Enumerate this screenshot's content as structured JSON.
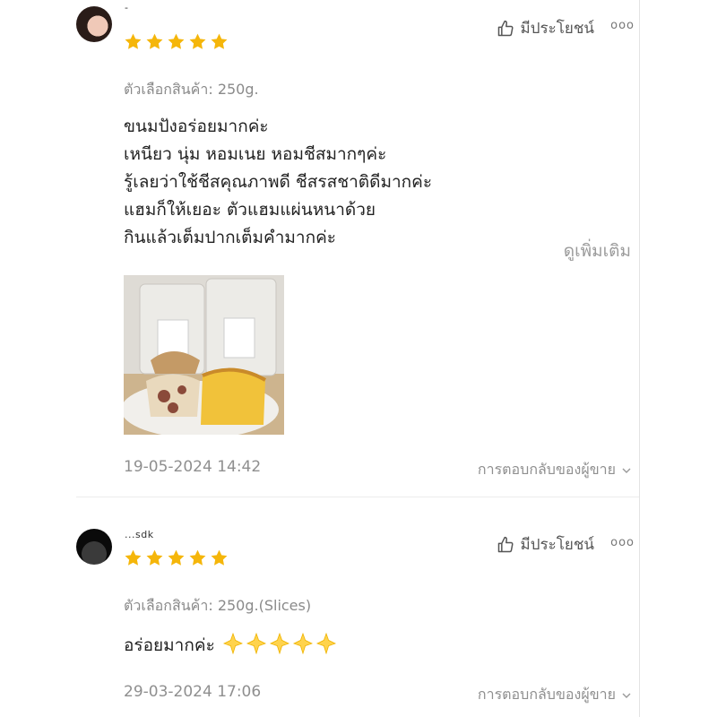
{
  "colors": {
    "star": "#f5b60a",
    "muted": "#8f8f8f",
    "text": "#222222"
  },
  "reviews": [
    {
      "username": "-",
      "rating": 5,
      "helpful_label": "มีประโยชน์",
      "more_label": "ooo",
      "variant": "ตัวเลือกสินค้า: 250g.",
      "comment_lines": [
        "ขนมปังอร่อยมากค่ะ",
        "เหนียว นุ่ม หอมเนย หอมชีสมากๆค่ะ",
        "รู้เลยว่าใช้ชีสคุณภาพดี ชีสรสชาติดีมากค่ะ",
        "แฮมก็ให้เยอะ ตัวแฮมแผ่นหนาด้วย",
        "กินแล้วเต็มปากเต็มคำมากค่ะ"
      ],
      "see_more": "ดูเพิ่มเติม",
      "date": "19-05-2024 14:42",
      "seller_reply": "การตอบกลับของผู้ขาย"
    },
    {
      "username": "...sdk",
      "rating": 5,
      "helpful_label": "มีประโยชน์",
      "more_label": "ooo",
      "variant": "ตัวเลือกสินค้า: 250g.(Slices)",
      "comment": "อร่อยมากค่ะ",
      "comment_emoji_count": 5,
      "date": "29-03-2024 17:06",
      "seller_reply": "การตอบกลับของผู้ขาย"
    }
  ]
}
